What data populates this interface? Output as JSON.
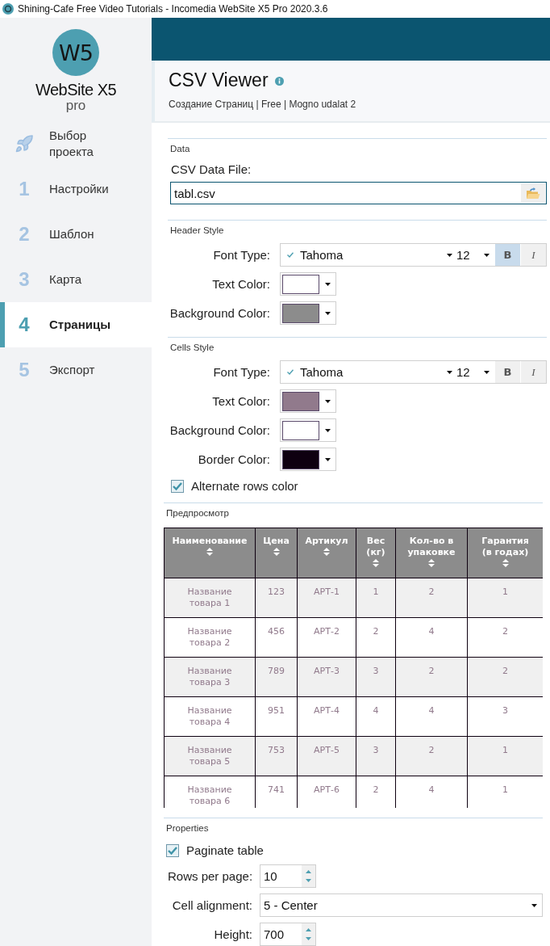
{
  "window": {
    "title": "Shining-Cafe Free Video Tutorials - Incomedia WebSite X5 Pro 2020.3.6"
  },
  "sidebar": {
    "logo": {
      "mark": "W5",
      "name": "WebSite X5",
      "edition": "pro"
    },
    "items": [
      {
        "kind": "icon",
        "label": "Выбор проекта",
        "selected": false
      },
      {
        "kind": "number",
        "number": "1",
        "label": "Настройки",
        "selected": false
      },
      {
        "kind": "number",
        "number": "2",
        "label": "Шаблон",
        "selected": false
      },
      {
        "kind": "number",
        "number": "3",
        "label": "Карта",
        "selected": false
      },
      {
        "kind": "number",
        "number": "4",
        "label": "Страницы",
        "selected": true
      },
      {
        "kind": "number",
        "number": "5",
        "label": "Экспорт",
        "selected": false
      }
    ]
  },
  "header": {
    "title": "CSV Viewer",
    "subtitle": "Создание Страниц | Free | Mogno udalat 2"
  },
  "data_section": {
    "title": "Data",
    "file_label": "CSV Data File:",
    "file_value": "tabl.csv"
  },
  "header_style": {
    "title": "Header Style",
    "font": {
      "label": "Font Type:",
      "family": "Tahoma",
      "size": "12",
      "styles": [
        {
          "kind": "bold",
          "label": "B",
          "selected": true
        },
        {
          "kind": "italic",
          "label": "I",
          "selected": false
        }
      ]
    },
    "colors": [
      {
        "label": "Text Color:",
        "color": "#ffffff"
      },
      {
        "label": "Background Color:",
        "color": "#8c8c8c"
      }
    ]
  },
  "cells_style": {
    "title": "Cells Style",
    "font": {
      "label": "Font Type:",
      "family": "Tahoma",
      "size": "12",
      "styles": [
        {
          "kind": "bold",
          "label": "B",
          "selected": false
        },
        {
          "kind": "italic",
          "label": "I",
          "selected": false
        }
      ]
    },
    "colors": [
      {
        "label": "Text Color:",
        "color": "#917a8c"
      },
      {
        "label": "Background Color:",
        "color": "#ffffff"
      },
      {
        "label": "Border Color:",
        "color": "#0e0010"
      }
    ],
    "alternate_rows": {
      "label": "Alternate rows color",
      "checked": true
    }
  },
  "preview": {
    "title": "Предпросмотр",
    "columns": [
      "Наименование",
      "Цена",
      "Артикул",
      "Вес (кг)",
      "Кол-во в упаковке",
      "Гарантия (в годах)"
    ],
    "rows": [
      [
        "Название товара 1",
        "123",
        "АРТ-1",
        "1",
        "2",
        "1"
      ],
      [
        "Название товара 2",
        "456",
        "АРТ-2",
        "2",
        "4",
        "2"
      ],
      [
        "Название товара 3",
        "789",
        "АРТ-3",
        "3",
        "2",
        "2"
      ],
      [
        "Название товара 4",
        "951",
        "АРТ-4",
        "4",
        "4",
        "3"
      ],
      [
        "Название товара 5",
        "753",
        "АРТ-5",
        "3",
        "2",
        "1"
      ],
      [
        "Название товара 6",
        "741",
        "АРТ-6",
        "2",
        "4",
        "1"
      ]
    ]
  },
  "properties": {
    "title": "Properties",
    "paginate": {
      "label": "Paginate table",
      "checked": true
    },
    "rows_per_page": {
      "label": "Rows per page:",
      "value": "10"
    },
    "cell_alignment": {
      "label": "Cell alignment:",
      "value": "5 - Center"
    },
    "height": {
      "label": "Height:",
      "value": "700"
    }
  }
}
